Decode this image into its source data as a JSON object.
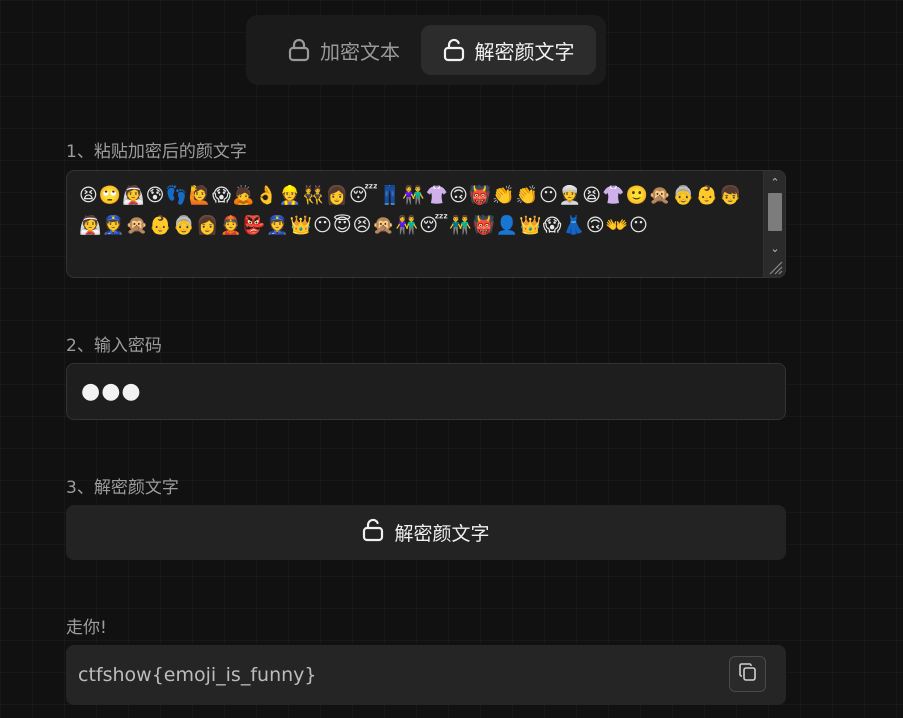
{
  "tabs": {
    "encrypt_label": "加密文本",
    "decrypt_label": "解密颜文字",
    "active": "decrypt"
  },
  "step1": {
    "label": "1、粘贴加密后的颜文字",
    "value": "😫🙄👰😰👣🙋😱🙇👌👷👯👩😴👖👫👚🙃👹👏👏😶👳😫👚🙂🙊👵👶👦👰👮🙊👶👵👩👲👺👮👑😶😇😣🙊👫😴👬👹👤👑😱👗🙃👐😶"
  },
  "step2": {
    "label": "2、输入密码",
    "masked_value": "●●●"
  },
  "step3": {
    "label": "3、解密颜文字",
    "button_label": "解密颜文字"
  },
  "result": {
    "label": "走你!",
    "value": "ctfshow{emoji_is_funny}"
  },
  "icons": {
    "encrypt_tab": "lock-icon",
    "decrypt_tab": "unlock-icon",
    "decrypt_button": "unlock-icon",
    "copy": "copy-icon"
  }
}
